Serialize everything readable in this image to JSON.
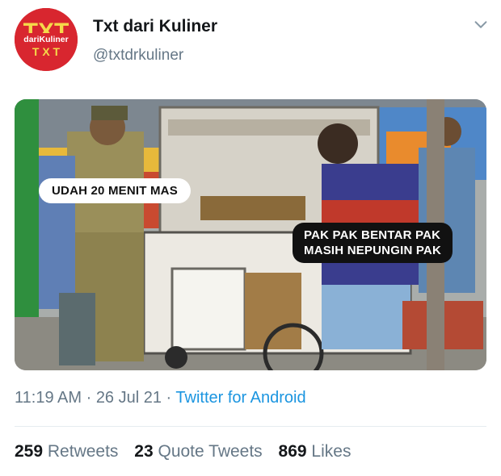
{
  "header": {
    "display_name": "Txt dari Kuliner",
    "handle": "@txtdrkuliner",
    "avatar_logo_text": "dariKuliner",
    "avatar_bg": "#d8262f",
    "menu_icon": "chevron-down-icon"
  },
  "media": {
    "caption_top": "UDAH 20 MENIT MAS",
    "caption_bottom_line1": "PAK PAK BENTAR PAK",
    "caption_bottom_line2": "MASIH NEPUNGIN PAK"
  },
  "meta": {
    "time": "11:19 AM",
    "sep1": " · ",
    "date": "26 Jul 21",
    "sep2": " · ",
    "source": "Twitter for Android",
    "source_color": "#1b95e0"
  },
  "stats": {
    "retweets_count": "259",
    "retweets_label": "Retweets",
    "quotes_count": "23",
    "quotes_label": "Quote Tweets",
    "likes_count": "869",
    "likes_label": "Likes"
  }
}
